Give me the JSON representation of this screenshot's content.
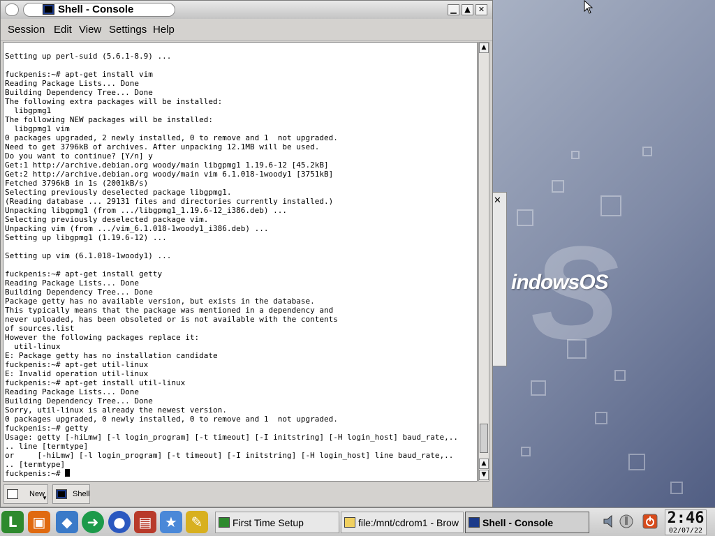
{
  "window": {
    "title": "Shell - Console",
    "buttons": {
      "minimize": "▁",
      "maximize": "▲",
      "close": "✕"
    }
  },
  "menu": [
    "Session",
    "Edit",
    "View",
    "Settings",
    "Help"
  ],
  "terminal": {
    "lines": [
      "Setting up perl-suid (5.6.1-8.9) ...",
      "",
      "fuckpenis:~# apt-get install vim",
      "Reading Package Lists... Done",
      "Building Dependency Tree... Done",
      "The following extra packages will be installed:",
      "  libgpmg1",
      "The following NEW packages will be installed:",
      "  libgpmg1 vim",
      "0 packages upgraded, 2 newly installed, 0 to remove and 1  not upgraded.",
      "Need to get 3796kB of archives. After unpacking 12.1MB will be used.",
      "Do you want to continue? [Y/n] y",
      "Get:1 http://archive.debian.org woody/main libgpmg1 1.19.6-12 [45.2kB]",
      "Get:2 http://archive.debian.org woody/main vim 6.1.018-1woody1 [3751kB]",
      "Fetched 3796kB in 1s (2001kB/s)",
      "Selecting previously deselected package libgpmg1.",
      "(Reading database ... 29131 files and directories currently installed.)",
      "Unpacking libgpmg1 (from .../libgpmg1_1.19.6-12_i386.deb) ...",
      "Selecting previously deselected package vim.",
      "Unpacking vim (from .../vim_6.1.018-1woody1_i386.deb) ...",
      "Setting up libgpmg1 (1.19.6-12) ...",
      "",
      "Setting up vim (6.1.018-1woody1) ...",
      "",
      "fuckpenis:~# apt-get install getty",
      "Reading Package Lists... Done",
      "Building Dependency Tree... Done",
      "Package getty has no available version, but exists in the database.",
      "This typically means that the package was mentioned in a dependency and",
      "never uploaded, has been obsoleted or is not available with the contents",
      "of sources.list",
      "However the following packages replace it:",
      "  util-linux",
      "E: Package getty has no installation candidate",
      "fuckpenis:~# apt-get util-linux",
      "E: Invalid operation util-linux",
      "fuckpenis:~# apt-get install util-linux",
      "Reading Package Lists... Done",
      "Building Dependency Tree... Done",
      "Sorry, util-linux is already the newest version.",
      "0 packages upgraded, 0 newly installed, 0 to remove and 1  not upgraded.",
      "fuckpenis:~# getty",
      "Usage: getty [-hiLmw] [-l login_program] [-t timeout] [-I initstring] [-H login_host] baud_rate,..",
      ".. line [termtype]",
      "or     [-hiLmw] [-l login_program] [-t timeout] [-I initstring] [-H login_host] line baud_rate,..",
      ".. [termtype]"
    ],
    "prompt": "fuckpenis:~# "
  },
  "tabs": [
    {
      "label": "New"
    },
    {
      "label": "Shell"
    }
  ],
  "desktop": {
    "logo_text": "indowsOS",
    "logo_big": "S"
  },
  "taskbar": {
    "launchers": [
      {
        "icon": "lindows-start-icon"
      },
      {
        "icon": "life-vest-icon"
      },
      {
        "icon": "cube-icon"
      },
      {
        "icon": "runner-icon"
      },
      {
        "icon": "globe-icon"
      },
      {
        "icon": "file-cabinet-icon"
      },
      {
        "icon": "running-man-icon"
      },
      {
        "icon": "broom-icon"
      }
    ],
    "tasks": [
      {
        "label": "First Time Setup",
        "active": false
      },
      {
        "label": "file:/mnt/cdrom1 - Brow",
        "active": false
      },
      {
        "label": "Shell - Console",
        "active": true
      }
    ],
    "clock": {
      "time": "2:46",
      "date": "02/07/22"
    }
  }
}
